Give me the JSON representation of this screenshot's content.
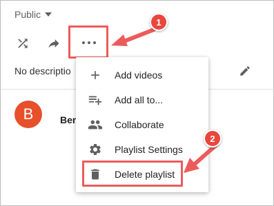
{
  "privacy": {
    "label": "Public"
  },
  "description": {
    "text": "No descriptio"
  },
  "owner": {
    "initial": "B",
    "name": "Ben"
  },
  "menu": {
    "items": [
      {
        "label": "Add videos",
        "icon": "plus-icon"
      },
      {
        "label": "Add all to...",
        "icon": "playlist-add-icon"
      },
      {
        "label": "Collaborate",
        "icon": "people-icon"
      },
      {
        "label": "Playlist Settings",
        "icon": "gear-icon"
      },
      {
        "label": "Delete playlist",
        "icon": "trash-icon"
      }
    ]
  },
  "annotations": {
    "step1": "1",
    "step2": "2"
  },
  "colors": {
    "annotation": "#ec5b5b",
    "badge": "#e9463d",
    "avatar": "#e8502c",
    "icon": "#606060"
  }
}
